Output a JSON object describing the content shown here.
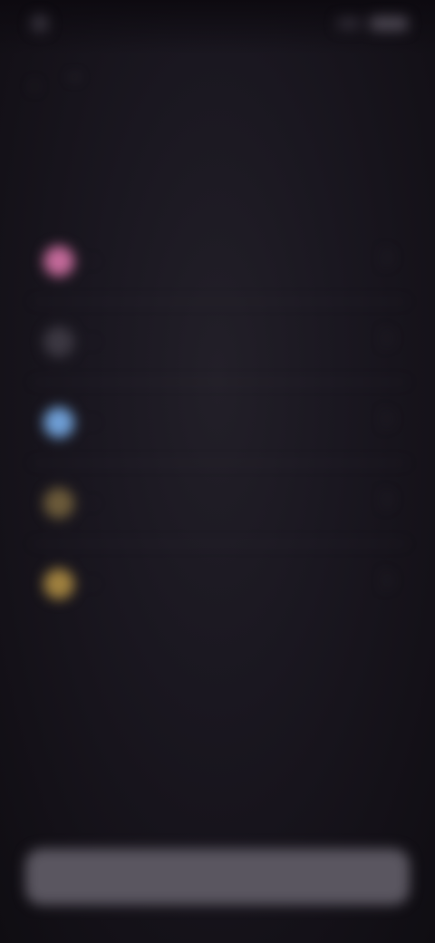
{
  "status_bar": {
    "time": "",
    "right_text": ""
  },
  "nav": {
    "back_icon": "chevron-left-icon",
    "title": ""
  },
  "heading": "",
  "options": [
    {
      "label": "",
      "icon": "pink-circle-icon",
      "color": "#c46a9a"
    },
    {
      "label": "",
      "icon": "gray-circle-icon",
      "color": "#3c3842"
    },
    {
      "label": "",
      "icon": "blue-circle-icon",
      "color": "#6f9fd6"
    },
    {
      "label": "",
      "icon": "olive-circle-icon",
      "color": "#6c5b3a"
    },
    {
      "label": "",
      "icon": "gold-circle-icon",
      "color": "#a0813f"
    }
  ],
  "cta": {
    "label": ""
  }
}
